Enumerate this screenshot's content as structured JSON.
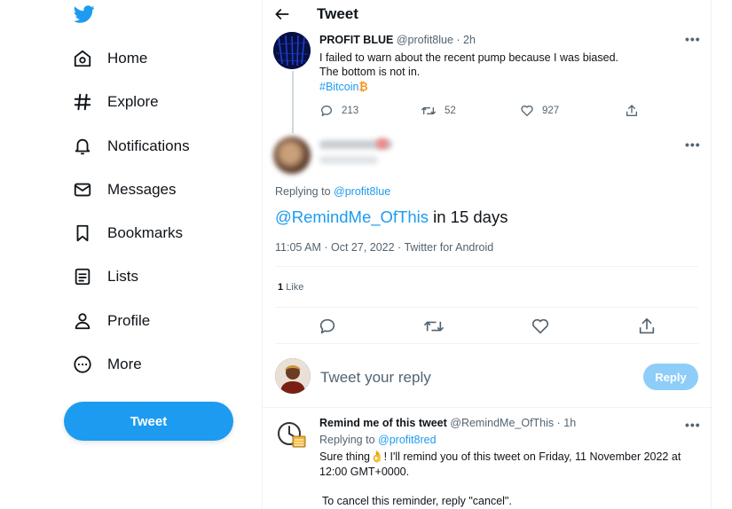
{
  "colors": {
    "accent": "#1d9bf0",
    "accent_disabled": "#8ecdf8",
    "muted": "#536471",
    "text": "#0f1419"
  },
  "sidebar": {
    "logo_icon": "twitter-bird-icon",
    "items": [
      {
        "label": "Home",
        "icon": "home-icon"
      },
      {
        "label": "Explore",
        "icon": "hashtag-icon"
      },
      {
        "label": "Notifications",
        "icon": "bell-icon"
      },
      {
        "label": "Messages",
        "icon": "envelope-icon"
      },
      {
        "label": "Bookmarks",
        "icon": "bookmark-icon"
      },
      {
        "label": "Lists",
        "icon": "list-icon"
      },
      {
        "label": "Profile",
        "icon": "person-icon"
      },
      {
        "label": "More",
        "icon": "more-circle-icon"
      }
    ],
    "tweet_button": "Tweet"
  },
  "header": {
    "title": "Tweet"
  },
  "parent_tweet": {
    "name": "PROFIT BLUE",
    "handle_time": "@profit8lue · 2h",
    "line1": "I failed to warn about the recent pump because I was biased.",
    "line2": "The bottom is not in.",
    "hashtag": "#Bitcoin",
    "emoji": "₿",
    "replies": "213",
    "retweets": "52",
    "likes": "927"
  },
  "main_tweet": {
    "replying_prefix": "Replying to",
    "replying_handle": "@profit8lue",
    "mention": "@RemindMe_OfThis",
    "text_rest": " in 15 days",
    "meta": "11:05 AM · Oct 27, 2022 · Twitter for Android",
    "like_count": "1",
    "like_label": "Like"
  },
  "reply_box": {
    "placeholder": "Tweet your reply",
    "button": "Reply"
  },
  "bot_tweet": {
    "name": "Remind me of this tweet",
    "handle_time": "@RemindMe_OfThis · 1h",
    "replying_prefix": "Replying to",
    "replying_handle": "@profit8red",
    "body_a": "Sure thing",
    "body_emoji": "👌",
    "body_b": "! I'll remind you of this tweet on Friday, 11 November 2022 at",
    "body_c": "12:00 GMT+0000.",
    "body_d": "To cancel this reminder, reply \"cancel\"."
  }
}
